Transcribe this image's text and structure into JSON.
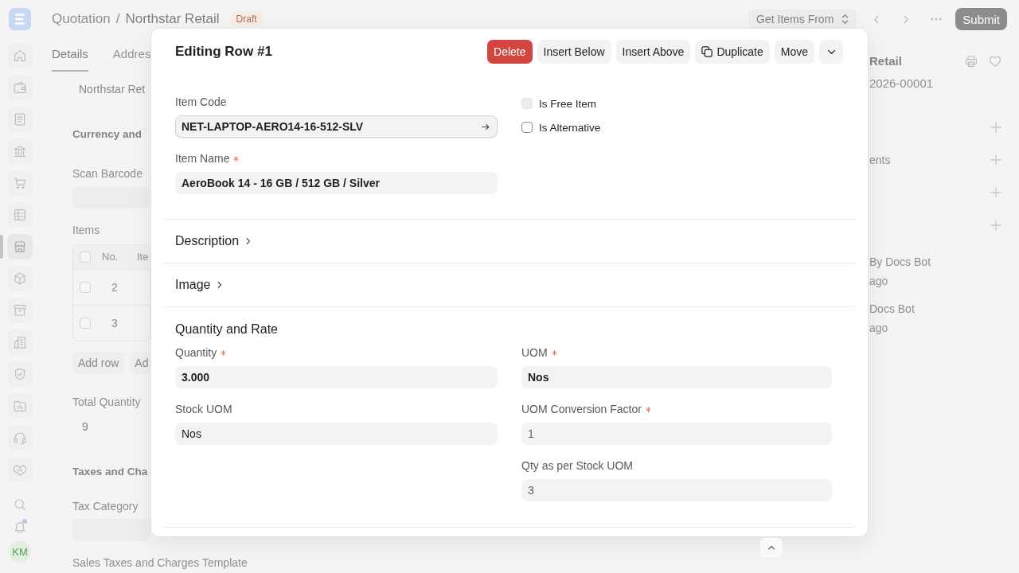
{
  "sidebar": {
    "items": [
      {
        "selected": false
      },
      {
        "selected": false
      },
      {
        "selected": false
      },
      {
        "selected": false
      },
      {
        "selected": false
      },
      {
        "selected": false
      },
      {
        "selected": true
      },
      {
        "selected": false
      },
      {
        "selected": false
      },
      {
        "selected": false
      },
      {
        "selected": false
      },
      {
        "selected": false
      },
      {
        "selected": false
      },
      {
        "selected": false
      }
    ],
    "unread_notifications": true,
    "avatar": "KM"
  },
  "topbar": {
    "breadcrumb": {
      "parent": "Quotation",
      "separator": "/",
      "current": "Northstar Retail"
    },
    "status": "Draft",
    "get_items": "Get Items From",
    "submit": "Submit"
  },
  "tabs": [
    {
      "label": "Details",
      "selected": true
    },
    {
      "label": "Addres",
      "selected": false
    }
  ],
  "form": {
    "customer_name": "Northstar Ret",
    "currency_section": "Currency and",
    "scan_barcode": {
      "label": "Scan Barcode"
    },
    "items": {
      "label": "Items",
      "header_checked": false,
      "columns": [
        "No.",
        "Ite"
      ],
      "rows": [
        {
          "no": "2",
          "checked": false
        },
        {
          "no": "3",
          "checked": false
        }
      ],
      "buttons": [
        "Add row",
        "Ad"
      ]
    },
    "total_quantity": {
      "label": "Total Quantity",
      "value": "9"
    },
    "taxes_section": "Taxes and Cha",
    "tax_category": {
      "label": "Tax Category"
    },
    "sales_taxes_template": {
      "label": "Sales Taxes and Charges Template"
    }
  },
  "side_panel": {
    "title": "Retail",
    "name": "2026-00001",
    "links": [
      {
        "kind": "add"
      },
      {
        "kind": "add",
        "label": "ents"
      },
      {
        "kind": "add"
      },
      {
        "kind": "add"
      }
    ],
    "activity": [
      {
        "text": "By Docs Bot",
        "time": "ago"
      },
      {
        "text": "Docs Bot",
        "time": "ago"
      }
    ]
  },
  "row_editor": {
    "title": "Editing Row #1",
    "actions": [
      {
        "kind": "danger",
        "label": "Delete"
      },
      {
        "kind": "plain",
        "label": "Insert Below"
      },
      {
        "kind": "plain",
        "label": "Insert Above"
      },
      {
        "kind": "copy",
        "label": "Duplicate"
      },
      {
        "kind": "plain",
        "label": "Move"
      },
      {
        "kind": "menu"
      }
    ],
    "item_fields": [
      {
        "label": "Item Code",
        "required": false,
        "value": "NET-LAPTOP-AERO14-16-512-SLV",
        "link": true,
        "bold": true,
        "read_only": false,
        "focused": true
      },
      {
        "label": "Item Name",
        "required": true,
        "value": "AeroBook 14 - 16 GB / 512 GB / Silver",
        "link": false,
        "bold": true,
        "read_only": false,
        "focused": false
      }
    ],
    "checkboxes": [
      {
        "label": "Is Free Item",
        "checked": false,
        "disabled": true
      },
      {
        "label": "Is Alternative",
        "checked": false,
        "disabled": false
      }
    ],
    "collapsed_sections": [
      {
        "title": "Description",
        "collapsed": true
      },
      {
        "title": "Image",
        "collapsed": true
      }
    ],
    "quantity_section": {
      "title": "Quantity and Rate",
      "left": [
        {
          "label": "Quantity",
          "required": true,
          "value": "3.000",
          "link": false,
          "bold": true,
          "read_only": false,
          "focused": false
        },
        {
          "label": "Stock UOM",
          "required": false,
          "value": "Nos",
          "link": false,
          "bold": false,
          "read_only": false,
          "focused": false
        }
      ],
      "right": [
        {
          "label": "UOM",
          "required": true,
          "value": "Nos",
          "link": false,
          "bold": true,
          "read_only": false,
          "focused": false
        },
        {
          "label": "UOM Conversion Factor",
          "required": true,
          "value": "1",
          "link": false,
          "bold": false,
          "read_only": true,
          "focused": false
        },
        {
          "label": "Qty as per Stock UOM",
          "required": false,
          "value": "3",
          "link": false,
          "bold": false,
          "read_only": true,
          "focused": false
        }
      ]
    }
  }
}
